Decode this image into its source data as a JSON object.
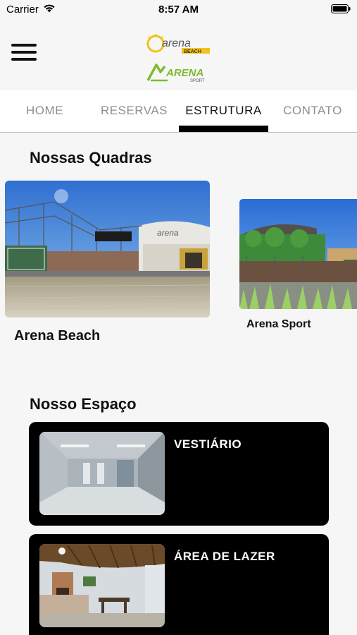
{
  "status_bar": {
    "carrier": "Carrier",
    "time": "8:57 AM"
  },
  "header": {
    "menu_icon": "hamburger-menu-icon",
    "logo_beach": {
      "main": "arena",
      "sub": "BEACH"
    },
    "logo_sport": {
      "main": "ARENA",
      "sub": "SPORT"
    }
  },
  "tabs": [
    {
      "label": "HOME",
      "active": false
    },
    {
      "label": "RESERVAS",
      "active": false
    },
    {
      "label": "ESTRUTURA",
      "active": true
    },
    {
      "label": "CONTATO",
      "active": false
    }
  ],
  "courts_section": {
    "title": "Nossas Quadras",
    "items": [
      {
        "name": "Arena Beach",
        "sign_text": "arena"
      },
      {
        "name": "Arena Sport"
      }
    ]
  },
  "spaces_section": {
    "title": "Nosso Espaço",
    "items": [
      {
        "title": "VESTIÁRIO"
      },
      {
        "title": "ÁREA DE LAZER"
      }
    ]
  },
  "colors": {
    "active_tab": "#111111",
    "inactive_tab": "#8e8e8e",
    "card_bg": "#000000",
    "logo_yellow": "#f2c21a",
    "logo_green": "#7dbb2f"
  }
}
